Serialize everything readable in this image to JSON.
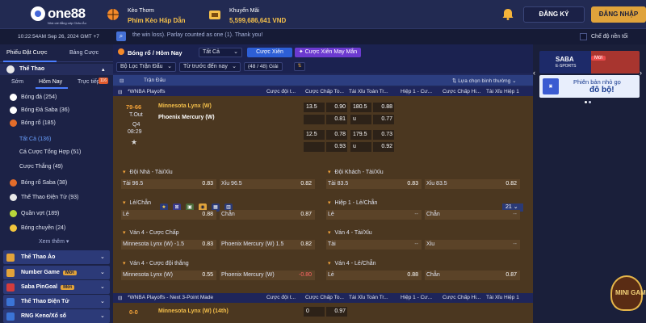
{
  "header": {
    "logo_text": "one88",
    "logo_tagline": "Nhà cái đẳng cấp Châu Âu",
    "keo_thom_title": "Kèo Thơm",
    "keo_thom_subtitle": "Phím Kèo Hấp Dẫn",
    "khuyen_mai_title": "Khuyến Mãi",
    "khuyen_mai_amount": "5,599,686,641 VND",
    "register_label": "ĐĂNG KÝ",
    "login_label": "ĐĂNG NHẬP"
  },
  "subbar": {
    "clock": "10:22:54AM Sep 26, 2024 GMT +7",
    "notice": "the win loss). Parlay counted as one (1). Thank you!",
    "night_mode_label": "Chế độ nền tối"
  },
  "sidebar": {
    "tabs": [
      "Phiếu Đặt Cược",
      "Bảng Cược"
    ],
    "sport_header": "Thể Thao",
    "sub_tabs": [
      "Sớm",
      "Hôm Nay",
      "Trực tiếp"
    ],
    "live_badge": "116",
    "items": [
      {
        "label": "Bóng đá (254)",
        "color": "#ffffff"
      },
      {
        "label": "Bóng Đá Saba (36)",
        "color": "#ffffff"
      },
      {
        "label": "Bóng rổ (185)",
        "color": "#e36c2a"
      }
    ],
    "subitems": [
      "Tất Cả (136)",
      "Cá Cược Tổng Hợp (51)",
      "Cược Thắng (49)"
    ],
    "items2": [
      {
        "label": "Bóng rổ Saba (38)",
        "color": "#e36c2a"
      },
      {
        "label": "Thể Thao Điện Tử (93)",
        "color": "#e8e8e8"
      },
      {
        "label": "Quần vợt (189)",
        "color": "#b9d63a"
      },
      {
        "label": "Bóng chuyền (24)",
        "color": "#f2c53d"
      }
    ],
    "see_more": "Xem thêm",
    "categories": [
      {
        "label": "Thể Thao Ảo",
        "new": "",
        "color": "#e2a33a"
      },
      {
        "label": "Number Game",
        "new": "Mới",
        "color": "#e2a33a"
      },
      {
        "label": "Saba PinGoal",
        "new": "Mới",
        "color": "#d43c3c"
      },
      {
        "label": "Thể Thao Điện Tử",
        "new": "",
        "color": "#3b74d6"
      },
      {
        "label": "RNG Keno/Xổ số",
        "new": "",
        "color": "#3b74d6"
      }
    ]
  },
  "main": {
    "title": "Bóng rổ / Hôm Nay",
    "select_all": "Tất Cả",
    "btn_xien": "Cược Xiên",
    "btn_xien_may_man": "Cược Xiên May Mắn",
    "filter_league": "Bộ Lọc Trận Đấu",
    "filter_time": "Từ trước đến nay",
    "count": "(48 / 48) Giải",
    "col_match": "Trận Đấu",
    "sort_label": "Lựa chọn bình thường",
    "col_headers": [
      "Cược đội t...",
      "Cược Chấp To...",
      "Tài Xỉu Toàn Tr...",
      "Hiệp 1 - Cư...",
      "Cược Chấp Hi...",
      "Tài Xỉu Hiệp 1"
    ],
    "league1": "*WNBA Playoffs",
    "league2": "*WNBA Playoffs - Next 3-Point Made",
    "match": {
      "score": "79-66",
      "status1": "T.Out",
      "status2": "Q4",
      "status3": "08:29",
      "team1": "Minnesota Lynx (W)",
      "team2": "Phoenix Mercury (W)",
      "odds": [
        [
          "13.5",
          "0.90",
          "180.5",
          "0.88"
        ],
        [
          "",
          "0.81",
          "u",
          "0.77"
        ],
        [
          "12.5",
          "0.78",
          "179.5",
          "0.73"
        ],
        [
          "",
          "0.93",
          "u",
          "0.92"
        ]
      ],
      "page": "21"
    },
    "groups": [
      {
        "title": "Đội Nhà - Tài/Xỉu",
        "cells": [
          [
            "Tài 96.5",
            "0.83"
          ],
          [
            "Xỉu 96.5",
            "0.82"
          ]
        ]
      },
      {
        "title": "Đội Khách - Tài/Xỉu",
        "cells": [
          [
            "Tài 83.5",
            "0.83"
          ],
          [
            "Xỉu 83.5",
            "0.82"
          ]
        ]
      },
      {
        "title": "Lẻ/Chẵn",
        "cells": [
          [
            "Lẻ",
            "0.88"
          ],
          [
            "Chẵn",
            "0.87"
          ]
        ]
      },
      {
        "title": "Hiệp 1 - Lẻ/Chẵn",
        "cells": [
          [
            "Lẻ",
            "--"
          ],
          [
            "Chẵn",
            "--"
          ]
        ]
      },
      {
        "title": "Ván 4 - Cược Chấp",
        "cells": [
          [
            "Minnesota Lynx (W) -1.5",
            "0.83"
          ],
          [
            "Phoenix Mercury (W) 1.5",
            "0.82"
          ]
        ]
      },
      {
        "title": "Ván 4 - Tài/Xỉu",
        "cells": [
          [
            "Tài",
            "--"
          ],
          [
            "Xỉu",
            "--"
          ]
        ]
      },
      {
        "title": "Ván 4 - Cược đội thắng",
        "cells": [
          [
            "Minnesota Lynx (W)",
            "0.55"
          ],
          [
            "Phoenix Mercury (W)",
            "-0.80"
          ]
        ]
      },
      {
        "title": "Ván 4 - Lẻ/Chẵn",
        "cells": [
          [
            "Lẻ",
            "0.88"
          ],
          [
            "Chẵn",
            "0.87"
          ]
        ]
      }
    ],
    "match2": {
      "score": "0-0",
      "team1": "Minnesota Lynx (W) (14th)",
      "odds": [
        "0",
        "0.97"
      ]
    }
  },
  "ads": {
    "saba_title": "SABA",
    "saba_sub": "E-SPORTS",
    "saba_new": "Mới",
    "ad2_line1": "Phiên bản nhỏ gọ",
    "ad2_line2": "đô bộ!",
    "minigame": "MINI GAME"
  }
}
